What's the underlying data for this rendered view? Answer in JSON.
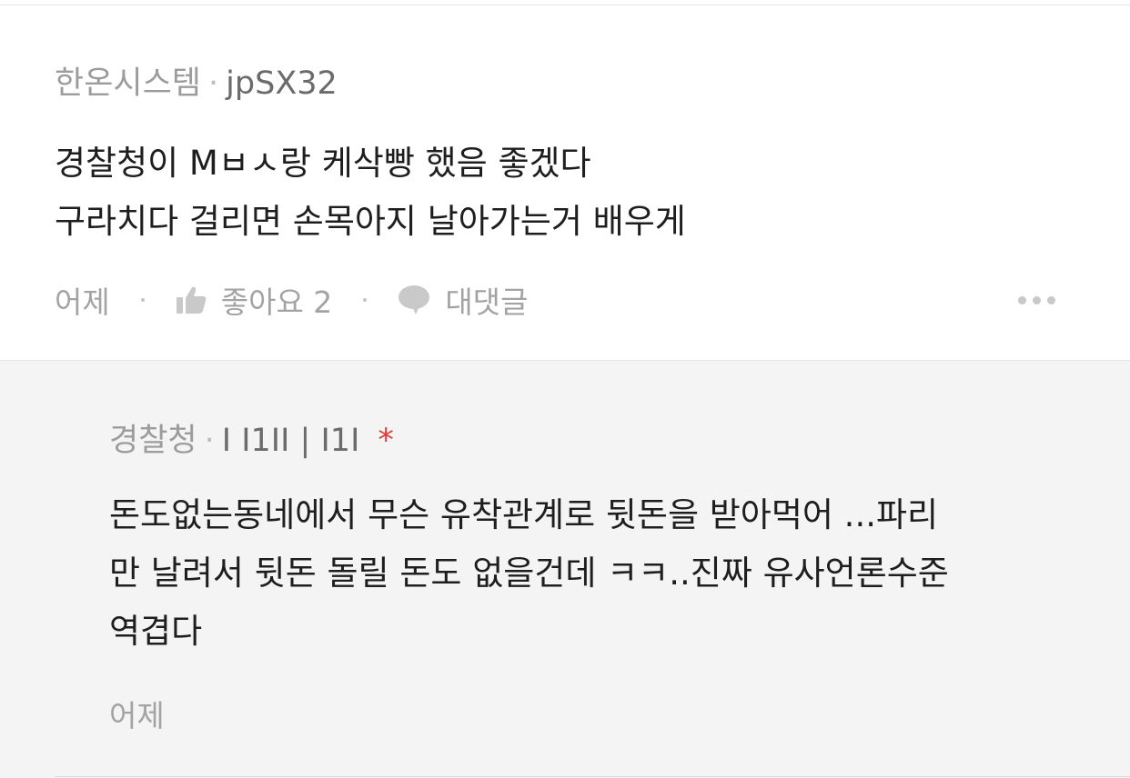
{
  "comment": {
    "author_name": "한온시스템",
    "separator": "·",
    "author_id": "jpSX32",
    "lines": [
      "경찰청이 Mㅂㅅ랑 케삭빵 했음 좋겠다",
      "구라치다 걸리면 손목아지 날아가는거 배우게"
    ],
    "time": "어제",
    "like_label": "좋아요 2",
    "reply_label": "대댓글",
    "icons": {
      "like": "thumbs-up-icon",
      "reply": "speech-bubble-icon",
      "more": "more-dots-icon"
    }
  },
  "reply": {
    "author_name": "경찰청",
    "separator": "·",
    "author_id": "I I1II | I1I",
    "badge": "*",
    "lines": [
      "돈도없는동네에서 무슨 유착관계로 뒷돈을 받아먹어 ...파리",
      "만 날려서 뒷돈 돌릴 돈도 없을건데 ㅋㅋ..진짜 유사언론수준",
      "역겹다"
    ],
    "time": "어제"
  },
  "colors": {
    "reply_background": "#f4f4f4",
    "badge_red": "#e03c3c",
    "muted_text": "#a3a3a3"
  }
}
